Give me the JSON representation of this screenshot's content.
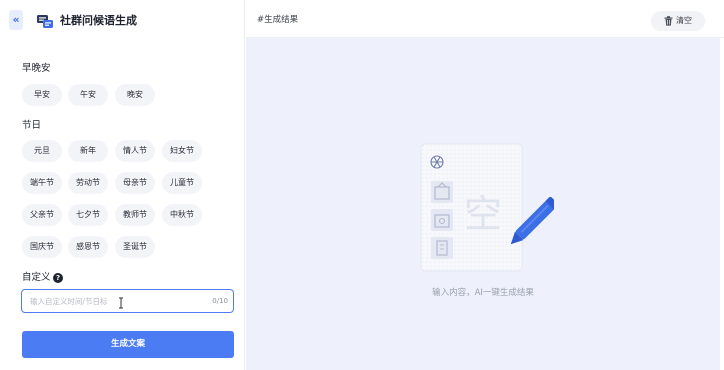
{
  "app": {
    "title": "社群问候语生成",
    "collapse_glyph": "«"
  },
  "sections": {
    "greetings": {
      "label": "早晚安",
      "chips": [
        "早安",
        "午安",
        "晚安"
      ]
    },
    "festivals": {
      "label": "节日",
      "chips": [
        "元旦",
        "新年",
        "情人节",
        "妇女节",
        "端午节",
        "劳动节",
        "母亲节",
        "儿童节",
        "父亲节",
        "七夕节",
        "教师节",
        "中秋节",
        "国庆节",
        "感恩节",
        "圣诞节"
      ]
    },
    "custom": {
      "label": "自定义",
      "help_glyph": "?",
      "placeholder": "输入自定义时间/节日标",
      "value": "",
      "counter": "0/10"
    }
  },
  "generate_label": "生成文案",
  "result": {
    "title": "#生成结果",
    "clear_label": "清空",
    "empty_text": "输入内容，AI一键生成结果",
    "empty_glyph": "空"
  },
  "colors": {
    "accent": "#4b7cf3",
    "panel_bg": "#eef1fb",
    "chip_bg": "#f3f4f8"
  },
  "icons": {
    "collapse": "chevrons-left-icon",
    "logo": "chat-bubbles-icon",
    "clear": "trash-icon",
    "empty": "empty-document-icon"
  }
}
